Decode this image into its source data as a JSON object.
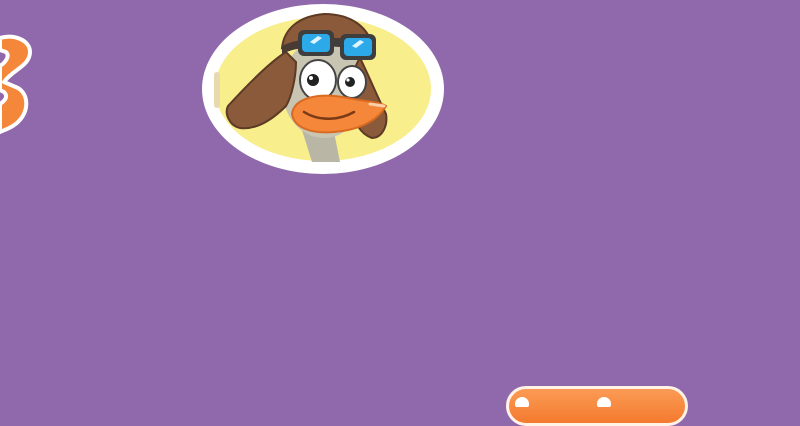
{
  "scene": {
    "background_color": "#9069ac",
    "character": {
      "name_icon": "pilot-duck-icon"
    },
    "logo_fragment": {
      "icon": "logo-letter-fragment",
      "color": "#f5873a"
    },
    "bottom_button": {
      "label": "",
      "color": "#f47a2e"
    }
  }
}
